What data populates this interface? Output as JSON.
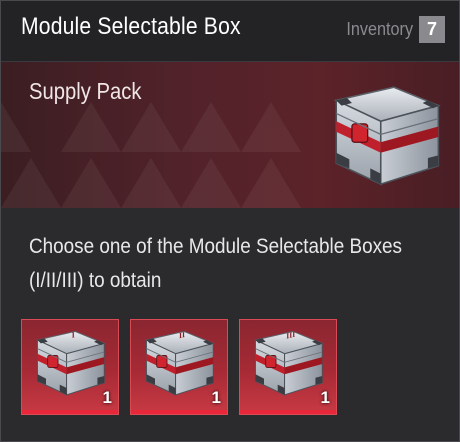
{
  "header": {
    "title": "Module Selectable Box",
    "inventory_label": "Inventory",
    "inventory_count": "7"
  },
  "banner": {
    "label": "Supply Pack",
    "icon": "supply-crate-icon"
  },
  "description": "Choose one of the Module Selectable Boxes (I/II/III) to obtain",
  "options": [
    {
      "icon": "module-box-i-icon",
      "marking": "I",
      "quantity": "1"
    },
    {
      "icon": "module-box-ii-icon",
      "marking": "II",
      "quantity": "1"
    },
    {
      "icon": "module-box-iii-icon",
      "marking": "III",
      "quantity": "1"
    }
  ],
  "colors": {
    "accent": "#e8283a",
    "header_bg": "#232326",
    "panel_bg": "#2b2b2e",
    "banner_bg": "#52222a"
  }
}
